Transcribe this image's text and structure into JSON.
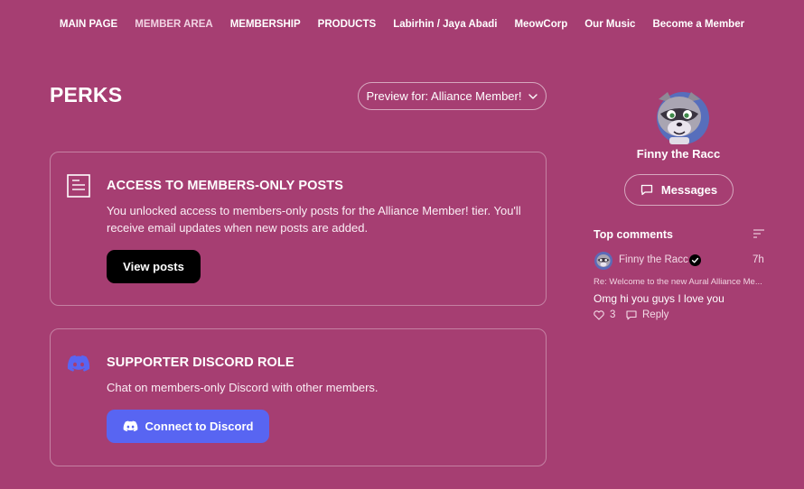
{
  "nav": {
    "items": [
      {
        "label": "MAIN PAGE"
      },
      {
        "label": "MEMBER AREA"
      },
      {
        "label": "MEMBERSHIP"
      },
      {
        "label": "PRODUCTS"
      },
      {
        "label": "Labirhin / Jaya Abadi"
      },
      {
        "label": "MeowCorp"
      },
      {
        "label": "Our Music"
      },
      {
        "label": "Become a Member"
      }
    ],
    "active_index": 1
  },
  "page": {
    "title": "PERKS",
    "preview_label": "Preview for: Alliance Member!"
  },
  "perks": [
    {
      "title": "ACCESS TO MEMBERS-ONLY POSTS",
      "description": "You unlocked access to members-only posts for the Alliance Member! tier. You'll receive email updates when new posts are added.",
      "button": "View posts",
      "icon": "document-icon"
    },
    {
      "title": "SUPPORTER DISCORD ROLE",
      "description": "Chat on members-only Discord with other members.",
      "button": "Connect to Discord",
      "icon": "discord-icon"
    }
  ],
  "sidebar": {
    "creator_name": "Finny the Racc",
    "messages_label": "Messages",
    "top_comments_label": "Top comments",
    "comment": {
      "author": "Finny the Racc",
      "time": "7h",
      "reference": "Re: Welcome to the new Aural Alliance Me...",
      "text": "Omg hi you guys I love you",
      "likes": "3",
      "reply_label": "Reply"
    }
  },
  "colors": {
    "background": "#a63e72",
    "discord": "#5865f2",
    "dark_button": "#000000"
  }
}
